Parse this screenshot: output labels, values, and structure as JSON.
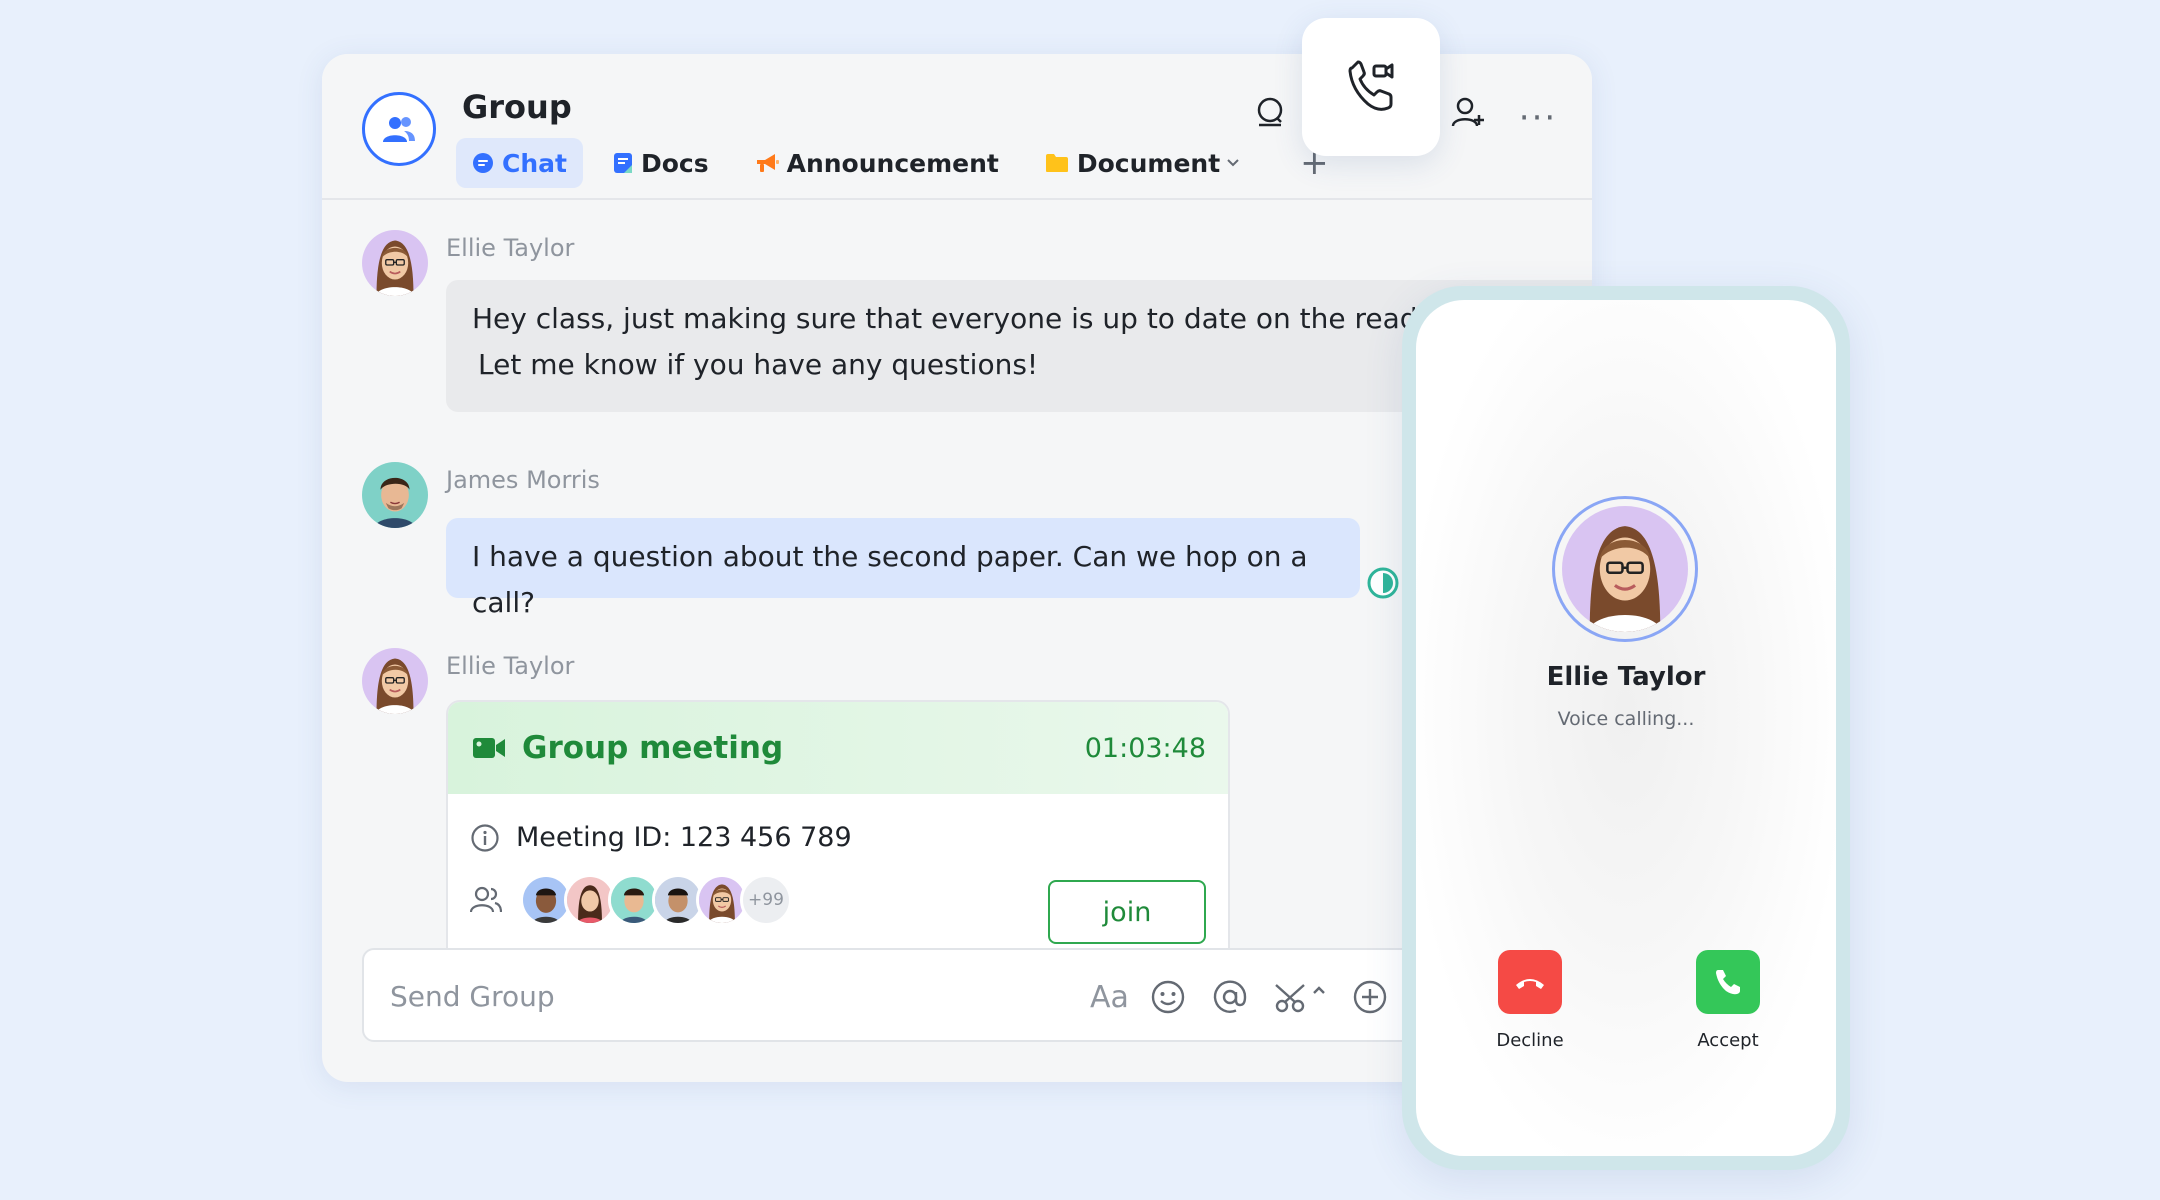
{
  "header": {
    "group_title": "Group",
    "tabs": [
      {
        "label": "Chat",
        "icon": "chat-bubble-icon"
      },
      {
        "label": "Docs",
        "icon": "docs-icon"
      },
      {
        "label": "Announcement",
        "icon": "megaphone-icon"
      },
      {
        "label": "Document",
        "icon": "folder-icon"
      }
    ],
    "add_tab": "+",
    "more": "···"
  },
  "messages": [
    {
      "sender": "Ellie Taylor",
      "text_line1": "Hey class, just making sure that everyone is up to date on the readings.",
      "text_line2": "Let me know if you have any questions!"
    },
    {
      "sender": "James Morris",
      "text": "I have a question about the second paper. Can we hop on a call?"
    },
    {
      "sender": "Ellie Taylor"
    }
  ],
  "meeting": {
    "title": "Group meeting",
    "duration": "01:03:48",
    "meeting_id": "Meeting ID: 123 456 789",
    "extra_participants": "+99",
    "join_label": "join"
  },
  "composer": {
    "placeholder": "Send Group",
    "format_label": "Aa"
  },
  "call": {
    "caller_name": "Ellie Taylor",
    "status": "Voice calling...",
    "decline_label": "Decline",
    "accept_label": "Accept"
  },
  "colors": {
    "accent": "#3370ff",
    "meeting_green": "#1f8a3a",
    "decline_red": "#f54a45",
    "accept_green": "#34c759",
    "phone_frame": "#cfe6ea"
  }
}
